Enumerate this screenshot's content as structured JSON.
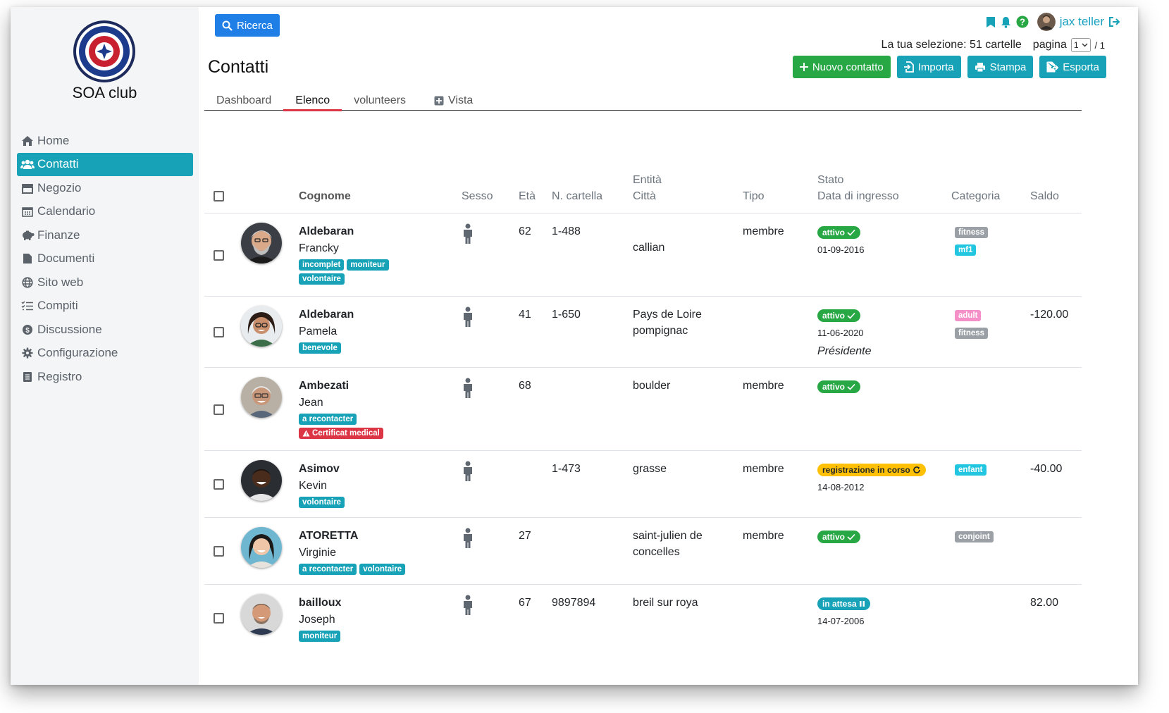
{
  "app": {
    "club_name": "SOA club",
    "accent": "#17a2b8"
  },
  "sidebar": {
    "items": [
      {
        "label": "Home",
        "icon": "home-icon"
      },
      {
        "label": "Contatti",
        "icon": "users-icon",
        "active": true
      },
      {
        "label": "Negozio",
        "icon": "store-icon"
      },
      {
        "label": "Calendario",
        "icon": "calendar-icon"
      },
      {
        "label": "Finanze",
        "icon": "piggy-bank-icon"
      },
      {
        "label": "Documenti",
        "icon": "file-icon"
      },
      {
        "label": "Sito web",
        "icon": "globe-icon"
      },
      {
        "label": "Compiti",
        "icon": "tasks-icon"
      },
      {
        "label": "Discussione",
        "icon": "dollar-circle-icon"
      },
      {
        "label": "Configurazione",
        "icon": "gear-icon"
      },
      {
        "label": "Registro",
        "icon": "book-icon"
      }
    ]
  },
  "header": {
    "search_label": "Ricerca",
    "user_name": "jax teller",
    "selection_text": "La tua selezione: 51 cartelle",
    "page_label": "pagina",
    "page_value": "1",
    "page_total": "/ 1",
    "title": "Contatti"
  },
  "actions": {
    "new_contact": "Nuovo contatto",
    "import": "Importa",
    "print": "Stampa",
    "export": "Esporta"
  },
  "tabs": [
    {
      "label": "Dashboard"
    },
    {
      "label": "Elenco",
      "active": true
    },
    {
      "label": "volunteers"
    },
    {
      "label": "Vista"
    }
  ],
  "table": {
    "headers": {
      "surname": "Cognome",
      "sex": "Sesso",
      "age": "Età",
      "card_no": "N. cartella",
      "entity": "Entità",
      "city": "Città",
      "type": "Tipo",
      "status": "Stato",
      "entry_date": "Data di ingresso",
      "category": "Categoria",
      "balance": "Saldo"
    },
    "rows": [
      {
        "last_name": "Aldebaran",
        "first_name": "Francky",
        "tags": [
          {
            "text": "incomplet",
            "color": "teal"
          },
          {
            "text": "moniteur",
            "color": "teal"
          },
          {
            "text": "volontaire",
            "color": "teal"
          }
        ],
        "age": "62",
        "card_no": "1-488",
        "entity": "",
        "city": "callian",
        "type": "membre",
        "status": "attivo",
        "status_style": "green",
        "status_icon": "check-icon",
        "date": "01-09-2016",
        "role": "",
        "categories": [
          {
            "text": "fitness",
            "color": "grey"
          },
          {
            "text": "mf1",
            "color": "cyan"
          }
        ],
        "balance": ""
      },
      {
        "last_name": "Aldebaran",
        "first_name": "Pamela",
        "tags": [
          {
            "text": "benevole",
            "color": "teal"
          }
        ],
        "age": "41",
        "card_no": "1-650",
        "entity": "Pays de Loire",
        "city": "pompignac",
        "type": "",
        "status": "attivo",
        "status_style": "green",
        "status_icon": "check-icon",
        "date": "11-06-2020",
        "role": "Présidente",
        "categories": [
          {
            "text": "adult",
            "color": "pink"
          },
          {
            "text": "fitness",
            "color": "grey"
          }
        ],
        "balance": "-120.00"
      },
      {
        "last_name": "Ambezati",
        "first_name": "Jean",
        "tags": [
          {
            "text": "a recontacter",
            "color": "teal"
          },
          {
            "text": "Certificat medical",
            "color": "red",
            "icon": "warning-icon"
          }
        ],
        "age": "68",
        "card_no": "",
        "entity": "",
        "city": "boulder",
        "type": "membre",
        "status": "attivo",
        "status_style": "green",
        "status_icon": "check-icon",
        "date": "",
        "role": "",
        "categories": [],
        "balance": ""
      },
      {
        "last_name": "Asimov",
        "first_name": "Kevin",
        "tags": [
          {
            "text": "volontaire",
            "color": "teal"
          }
        ],
        "age": "",
        "card_no": "1-473",
        "entity": "",
        "city": "grasse",
        "type": "membre",
        "status": "registrazione in corso",
        "status_style": "yellow",
        "status_icon": "refresh-icon",
        "date": "14-08-2012",
        "role": "",
        "categories": [
          {
            "text": "enfant",
            "color": "cyan"
          }
        ],
        "balance": "-40.00"
      },
      {
        "last_name": "ATORETTA",
        "first_name": "Virginie",
        "tags": [
          {
            "text": "a recontacter",
            "color": "teal"
          },
          {
            "text": "volontaire",
            "color": "teal"
          }
        ],
        "age": "27",
        "card_no": "",
        "entity": "",
        "city": "saint-julien de concelles",
        "type": "membre",
        "status": "attivo",
        "status_style": "green",
        "status_icon": "check-icon",
        "date": "",
        "role": "",
        "categories": [
          {
            "text": "conjoint",
            "color": "grey"
          }
        ],
        "balance": ""
      },
      {
        "last_name": "bailloux",
        "first_name": "Joseph",
        "tags": [
          {
            "text": "moniteur",
            "color": "teal"
          }
        ],
        "age": "67",
        "card_no": "9897894",
        "entity": "",
        "city": "breil sur roya",
        "type": "",
        "status": "in attesa",
        "status_style": "teal",
        "status_icon": "pause-icon",
        "date": "14-07-2006",
        "role": "",
        "categories": [],
        "balance": "82.00"
      }
    ]
  }
}
